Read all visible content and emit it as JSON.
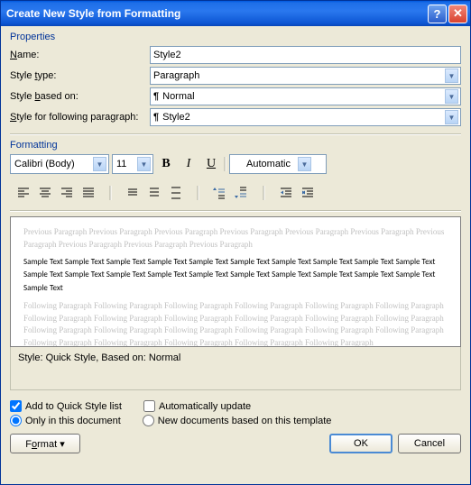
{
  "title": "Create New Style from Formatting",
  "properties_label": "Properties",
  "formatting_label": "Formatting",
  "fields": {
    "name_label": "Name:",
    "name_value": "Style2",
    "type_label": "Style type:",
    "type_value": "Paragraph",
    "based_label": "Style based on:",
    "based_value": "Normal",
    "following_label": "Style for following paragraph:",
    "following_value": "Style2"
  },
  "format": {
    "font": "Calibri (Body)",
    "size": "11",
    "color": "Automatic"
  },
  "preview": {
    "before": "Previous Paragraph Previous Paragraph Previous Paragraph Previous Paragraph Previous Paragraph Previous Paragraph Previous Paragraph Previous Paragraph Previous Paragraph Previous Paragraph",
    "sample": "Sample Text Sample Text Sample Text Sample Text Sample Text Sample Text Sample Text Sample Text Sample Text Sample Text Sample Text Sample Text Sample Text Sample Text Sample Text Sample Text Sample Text Sample Text Sample Text Sample Text Sample Text",
    "after": "Following Paragraph Following Paragraph Following Paragraph Following Paragraph Following Paragraph Following Paragraph Following Paragraph Following Paragraph Following Paragraph Following Paragraph Following Paragraph Following Paragraph Following Paragraph Following Paragraph Following Paragraph Following Paragraph Following Paragraph Following Paragraph Following Paragraph Following Paragraph Following Paragraph Following Paragraph Following Paragraph"
  },
  "description": "Style: Quick Style, Based on: Normal",
  "checks": {
    "quick": "Add to Quick Style list",
    "auto": "Automatically update",
    "doc": "Only in this document",
    "template": "New documents based on this template"
  },
  "buttons": {
    "format": "Format",
    "ok": "OK",
    "cancel": "Cancel"
  }
}
